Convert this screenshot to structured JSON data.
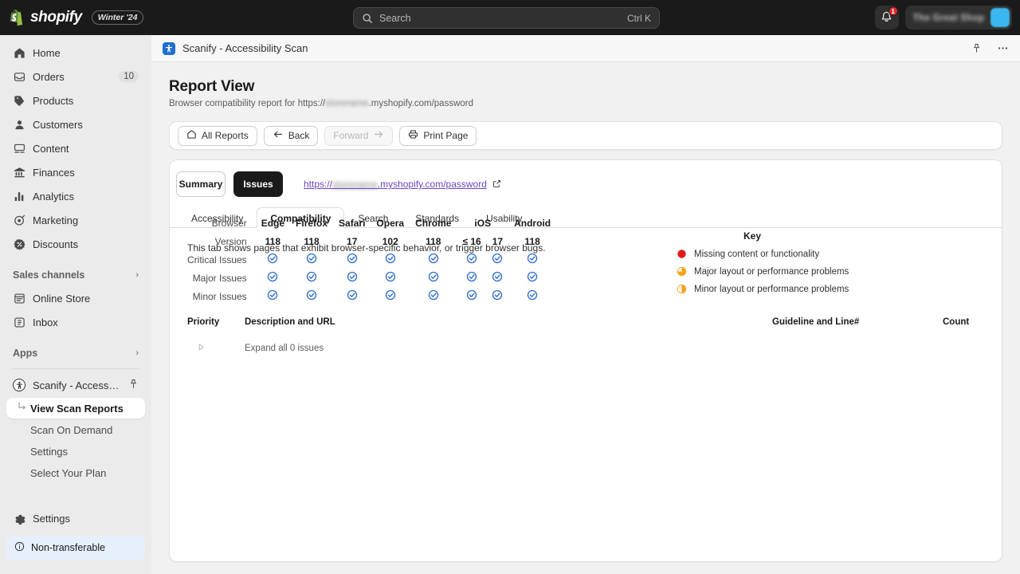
{
  "topbar": {
    "brand": "shopify",
    "season_badge": "Winter '24",
    "search": {
      "placeholder": "Search",
      "shortcut": "Ctrl K"
    },
    "notifications": {
      "count": "1"
    },
    "account": {
      "name": "The Great Shop"
    }
  },
  "sidebar": {
    "items": [
      {
        "label": "Home",
        "icon": "home-icon",
        "count": ""
      },
      {
        "label": "Orders",
        "icon": "orders-icon",
        "count": "10"
      },
      {
        "label": "Products",
        "icon": "products-icon",
        "count": ""
      },
      {
        "label": "Customers",
        "icon": "customers-icon",
        "count": ""
      },
      {
        "label": "Content",
        "icon": "content-icon",
        "count": ""
      },
      {
        "label": "Finances",
        "icon": "finances-icon",
        "count": ""
      },
      {
        "label": "Analytics",
        "icon": "analytics-icon",
        "count": ""
      },
      {
        "label": "Marketing",
        "icon": "marketing-icon",
        "count": ""
      },
      {
        "label": "Discounts",
        "icon": "discounts-icon",
        "count": ""
      }
    ],
    "sales_channels": {
      "title": "Sales channels",
      "items": [
        {
          "label": "Online Store",
          "icon": "online-store-icon"
        },
        {
          "label": "Inbox",
          "icon": "inbox-icon"
        }
      ]
    },
    "apps": {
      "title": "Apps",
      "app_name": "Scanify - Accessibility ...",
      "sub_items": [
        {
          "label": "View Scan Reports",
          "active": true
        },
        {
          "label": "Scan On Demand",
          "active": false
        },
        {
          "label": "Settings",
          "active": false
        },
        {
          "label": "Select Your Plan",
          "active": false
        }
      ]
    },
    "settings_label": "Settings",
    "banner": {
      "label": "Non-transferable",
      "icon": "info-icon"
    }
  },
  "app_header": {
    "title": "Scanify - Accessibility Scan",
    "pin_icon": "pin-icon",
    "more_icon": "more-icon"
  },
  "page": {
    "title": "Report View",
    "subtitle_prefix": "Browser compatibility report for https://",
    "subtitle_store": "storename",
    "subtitle_suffix": ".myshopify.com/password"
  },
  "toolbar": {
    "buttons": [
      {
        "label": "All Reports",
        "icon": "home-icon",
        "disabled": false
      },
      {
        "label": "Back",
        "icon": "arrow-left-icon",
        "disabled": false
      },
      {
        "label": "Forward",
        "icon": "arrow-right-icon",
        "disabled": true
      },
      {
        "label": "Print Page",
        "icon": "printer-icon",
        "disabled": false
      }
    ]
  },
  "report": {
    "segments": [
      {
        "label": "Summary",
        "active": false
      },
      {
        "label": "Issues",
        "active": true
      }
    ],
    "url_prefix": "https://",
    "url_store": "storename",
    "url_suffix": ".myshopify.com/password",
    "tabs": [
      {
        "label": "Accessibility",
        "active": false
      },
      {
        "label": "Compatibility",
        "active": true
      },
      {
        "label": "Search",
        "active": false
      },
      {
        "label": "Standards",
        "active": false
      },
      {
        "label": "Usability",
        "active": false
      }
    ],
    "tab_description": "This tab shows pages that exhibit browser-specific behavior, or trigger browser bugs.",
    "matrix": {
      "row_labels": [
        "Browser",
        "Version",
        "Critical Issues",
        "Major Issues",
        "Minor Issues"
      ],
      "browsers": [
        {
          "name": "Edge",
          "span": 1
        },
        {
          "name": "Firefox",
          "span": 1
        },
        {
          "name": "Safari",
          "span": 1
        },
        {
          "name": "Opera",
          "span": 1
        },
        {
          "name": "Chrome",
          "span": 1
        },
        {
          "name": "iOS",
          "span": 2
        },
        {
          "name": "Android",
          "span": 1
        }
      ],
      "versions": [
        "118",
        "118",
        "17",
        "102",
        "118",
        "≤ 16",
        "17",
        "118"
      ],
      "status_rows": [
        {
          "label": "Critical Issues",
          "cells": [
            "ok",
            "ok",
            "ok",
            "ok",
            "ok",
            "ok",
            "ok",
            "ok"
          ]
        },
        {
          "label": "Major Issues",
          "cells": [
            "ok",
            "ok",
            "ok",
            "ok",
            "ok",
            "ok",
            "ok",
            "ok"
          ]
        },
        {
          "label": "Minor Issues",
          "cells": [
            "ok",
            "ok",
            "ok",
            "ok",
            "ok",
            "ok",
            "ok",
            "ok"
          ]
        }
      ]
    },
    "key": {
      "title": "Key",
      "entries": [
        {
          "label": "Missing content or functionality",
          "shape": "full-circle",
          "color": "#e01b1b"
        },
        {
          "label": "Major layout or performance problems",
          "shape": "three-quarter-circle",
          "color": "#f2a51c"
        },
        {
          "label": "Minor layout or performance problems",
          "shape": "half-circle",
          "color": "#f2a51c"
        }
      ]
    },
    "issues_table": {
      "headers": [
        "Priority",
        "Description and URL",
        "Guideline and Line#",
        "Count"
      ],
      "expand_label": "Expand all 0 issues"
    }
  },
  "colors": {
    "accent_blue": "#2b6fd4",
    "check_blue": "#2f6fd0",
    "link_purple": "#6b46c1",
    "badge_red": "#e02929"
  }
}
